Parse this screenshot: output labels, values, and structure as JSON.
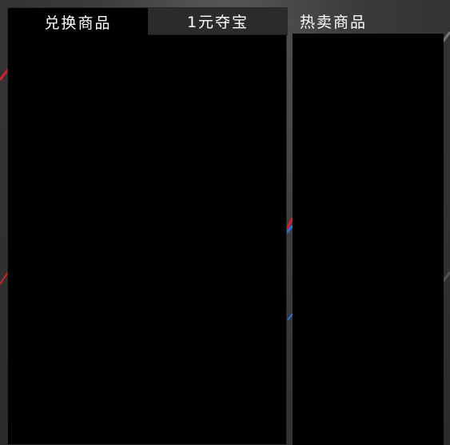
{
  "tabs": [
    {
      "label": "兑换商品",
      "active": true
    },
    {
      "label": "1元夺宝",
      "active": false
    }
  ],
  "side": {
    "title": "热卖商品"
  },
  "colors": {
    "accent_red": "#d8202a",
    "accent_blue": "#2f6fd0",
    "panel": "#000000",
    "tab_inactive": "#2b2b2b"
  }
}
